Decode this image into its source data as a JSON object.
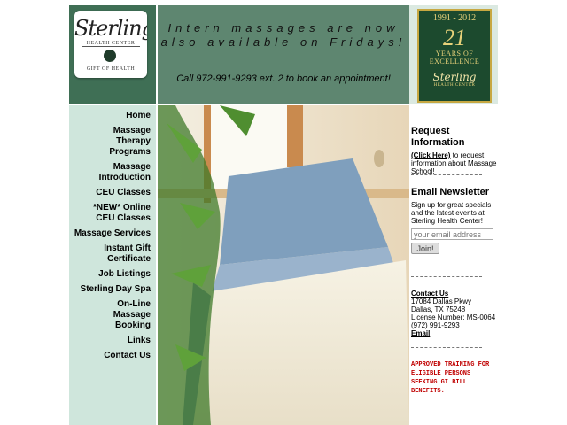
{
  "logo": {
    "script": "Sterling",
    "health_center": "HEALTH CENTER",
    "gift": "GIFT OF HEALTH"
  },
  "banner": {
    "announcement": "Intern massages are now also available on Fridays!",
    "call": "Call 972-991-9293 ext. 2 to book an appointment!"
  },
  "badge": {
    "years": "1991 - 2012",
    "number": "21",
    "line1": "YEARS OF",
    "line2": "EXCELLENCE",
    "brand": "Sterling",
    "sub": "HEALTH CENTER"
  },
  "nav": [
    {
      "label": "Home"
    },
    {
      "label": "Massage Therapy Programs"
    },
    {
      "label": "Massage Introduction"
    },
    {
      "label": "CEU Classes"
    },
    {
      "label": "*NEW* Online CEU Classes"
    },
    {
      "label": "Massage Services"
    },
    {
      "label": "Instant Gift Certificate"
    },
    {
      "label": "Job Listings"
    },
    {
      "label": "Sterling Day Spa"
    },
    {
      "label": "On-Line Massage Booking"
    },
    {
      "label": "Links"
    },
    {
      "label": "Contact Us"
    }
  ],
  "request": {
    "title": "Request Information",
    "link": "(Click Here)",
    "text": " to request information about Massage School!"
  },
  "newsletter": {
    "title": "Email Newsletter",
    "text": "Sign up for great specials and the latest events at Sterling Health Center!",
    "placeholder": "your email address",
    "button": "Join!"
  },
  "contact": {
    "link": "Contact Us",
    "address1": "17084 Dallas Pkwy",
    "address2": "Dallas, TX 75248",
    "license": "License Number: MS-0064",
    "phone": "(972) 991-9293",
    "email": "Email"
  },
  "gi_notice": "APPROVED TRAINING FOR ELIGIBLE PERSONS SEEKING GI BILL BENEFITS.",
  "colors": {
    "header_green": "#3f6f55",
    "banner_green": "#5e8670",
    "sidebar_mint": "#cfe6dc",
    "badge_green": "#1c4a2e",
    "gold": "#c7a842",
    "alert_red": "#c00000"
  }
}
